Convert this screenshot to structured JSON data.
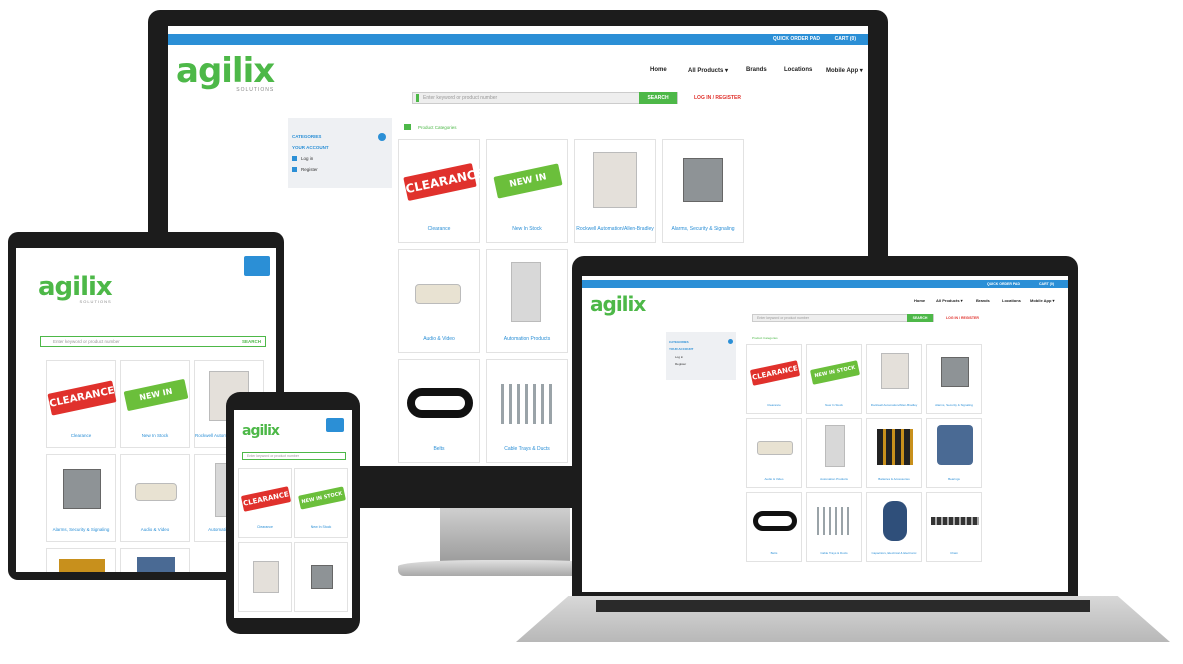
{
  "brand": {
    "logo": "agilix",
    "sub": "SOLUTIONS"
  },
  "topbar": {
    "quick_order": "QUICK ORDER PAD",
    "cart": "CART (0)"
  },
  "nav": [
    "Home",
    "All Products ▾",
    "Brands",
    "Locations",
    "Mobile App ▾"
  ],
  "search": {
    "placeholder": "Enter keyword or product number",
    "button": "SEARCH",
    "login": "LOG IN / REGISTER"
  },
  "sidebar": {
    "categories": "CATEGORIES",
    "account": "YOUR ACCOUNT",
    "login": "Log in",
    "register": "Register"
  },
  "breadcrumb": "Product Categories",
  "tiles": [
    {
      "caption": "Clearance",
      "tag": "CLEARANCE"
    },
    {
      "caption": "New In Stock",
      "tag": "NEW IN STOCK"
    },
    {
      "caption": "Rockwell Automation/Allen-Bradley"
    },
    {
      "caption": "Alarms, Security & Signaling"
    },
    {
      "caption": "Audio & Video"
    },
    {
      "caption": "Automation Products"
    },
    {
      "caption": "Batteries & Accessories"
    },
    {
      "caption": "Bearings"
    },
    {
      "caption": "Belts"
    },
    {
      "caption": "Cable Trays & Ducts"
    },
    {
      "caption": "Capacitors, Electrical & Electronic"
    },
    {
      "caption": "Chain"
    }
  ],
  "colors": {
    "brand_green": "#4db848",
    "topbar_blue": "#2b8fd6",
    "clearance_red": "#e0312c",
    "link_red": "#e0312c"
  }
}
